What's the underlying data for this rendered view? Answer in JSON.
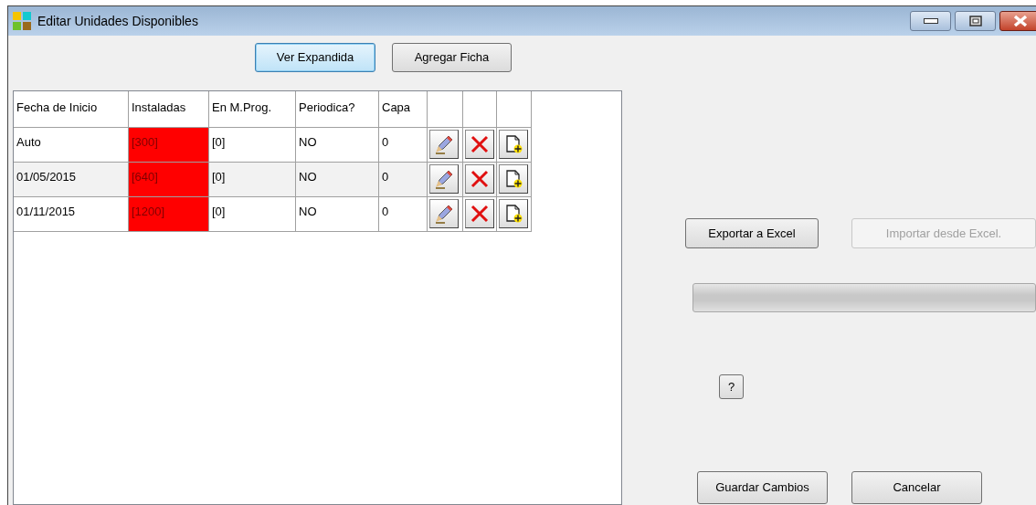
{
  "window": {
    "title": "Editar Unidades Disponibles"
  },
  "toolbar": [
    {
      "label": "Ver Expandida",
      "focused": true
    },
    {
      "label": "Agregar Ficha",
      "focused": false
    }
  ],
  "grid": {
    "columns": [
      "Fecha de Inicio",
      "Instaladas",
      "En M.Prog.",
      "Periodica?",
      "Capa"
    ],
    "rows": [
      {
        "cells": [
          "Auto",
          "[300]",
          "[0]",
          "NO",
          "0"
        ],
        "alert": true,
        "selected": false
      },
      {
        "cells": [
          "01/05/2015",
          "[640]",
          "[0]",
          "NO",
          "0"
        ],
        "alert": true,
        "selected": false
      },
      {
        "cells": [
          "01/11/2015",
          "[1200]",
          "[0]",
          "NO",
          "0"
        ],
        "alert": true,
        "selected": false
      }
    ]
  },
  "excel": [
    {
      "label": "Exportar a Excel",
      "disabled": false
    },
    {
      "label": "Importar desde Excel.",
      "disabled": true
    }
  ],
  "progress": {
    "level": 0
  },
  "help": {
    "label": "?"
  },
  "footer": [
    {
      "label": "Guardar Cambios"
    },
    {
      "label": "Cancelar"
    }
  ]
}
